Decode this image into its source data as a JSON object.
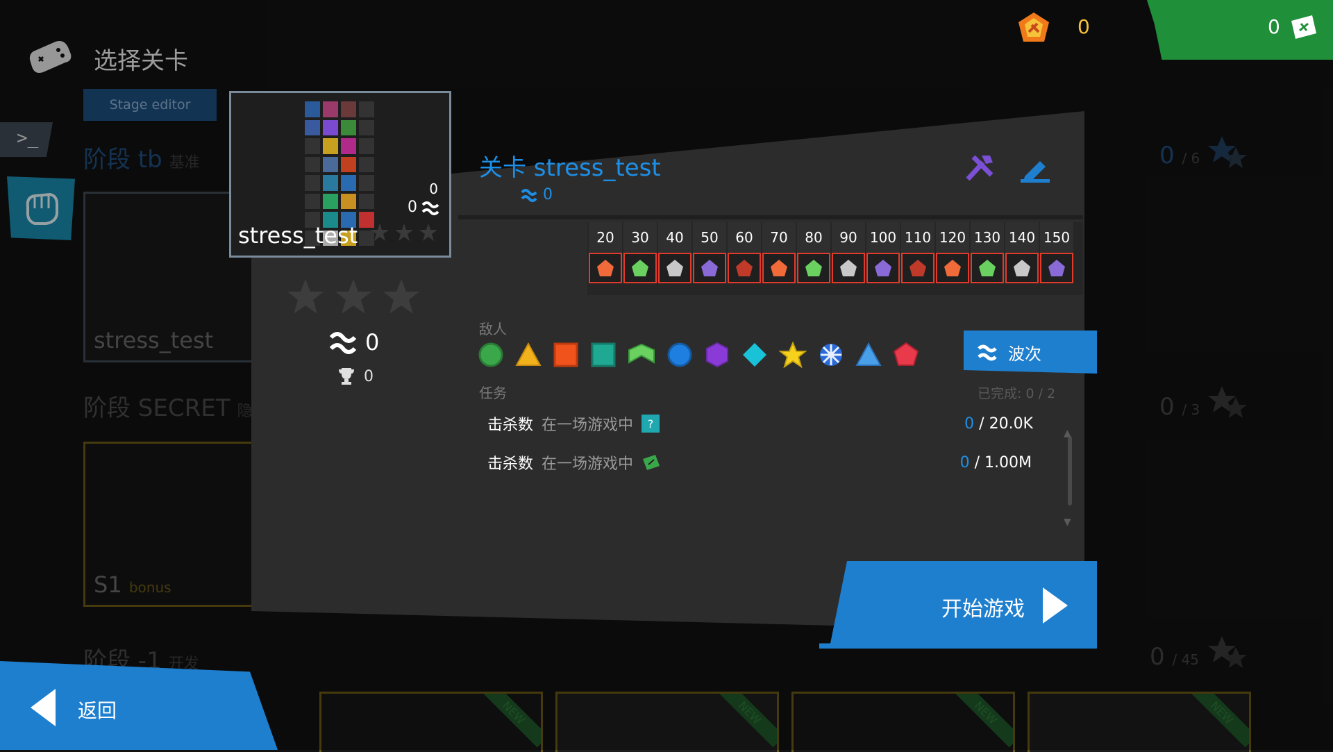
{
  "header": {
    "title": "选择关卡"
  },
  "top_bar": {
    "coins": "0",
    "tickets": "0",
    "accent_orange": "#f07a1a",
    "accent_green": "#1f8f3a"
  },
  "stage_editor_label": "Stage editor",
  "stages": [
    {
      "heading": "阶段 tb",
      "sub": "基准",
      "count": "0",
      "total": "/ 6",
      "level_name": "stress_test"
    },
    {
      "heading": "阶段 SECRET",
      "sub": "隐藏",
      "count": "0",
      "total": "/ 3",
      "level_name": "S1",
      "level_sub": "bonus"
    },
    {
      "heading": "阶段 -1",
      "sub": "开发",
      "count": "0",
      "total": "/ 45"
    }
  ],
  "popup": {
    "thumb": {
      "name": "stress_test",
      "value_top": "0",
      "value_waves": "0"
    },
    "stars_total": 3,
    "stars_earned": 0,
    "waves_record": "0",
    "trophy_record": "0",
    "level_title": "关卡 stress_test",
    "level_waves": "0",
    "wave_numbers": [
      "20",
      "30",
      "40",
      "50",
      "60",
      "70",
      "80",
      "90",
      "100",
      "110",
      "120",
      "130",
      "140",
      "150"
    ],
    "enemies_label": "敌人",
    "tasks_label": "任务",
    "tasks_done": "已完成: 0 / 2",
    "waves_button": "波次",
    "tasks": [
      {
        "name": "击杀数",
        "cond": "在一场游戏中",
        "progress": "0",
        "target": "/ 20.0K",
        "reward_icon": "question-box-icon"
      },
      {
        "name": "击杀数",
        "cond": "在一场游戏中",
        "progress": "0",
        "target": "/ 1.00M",
        "reward_icon": "ticket-icon"
      }
    ],
    "start_button": "开始游戏"
  },
  "back_button": "返回",
  "new_badge": "NEW",
  "colors": {
    "blue": "#1e7fcf",
    "blue_text": "#1e8fe6",
    "panel": "#2b2b2b",
    "border_blue": "#5b6f80",
    "purple": "#7b4fd6"
  }
}
